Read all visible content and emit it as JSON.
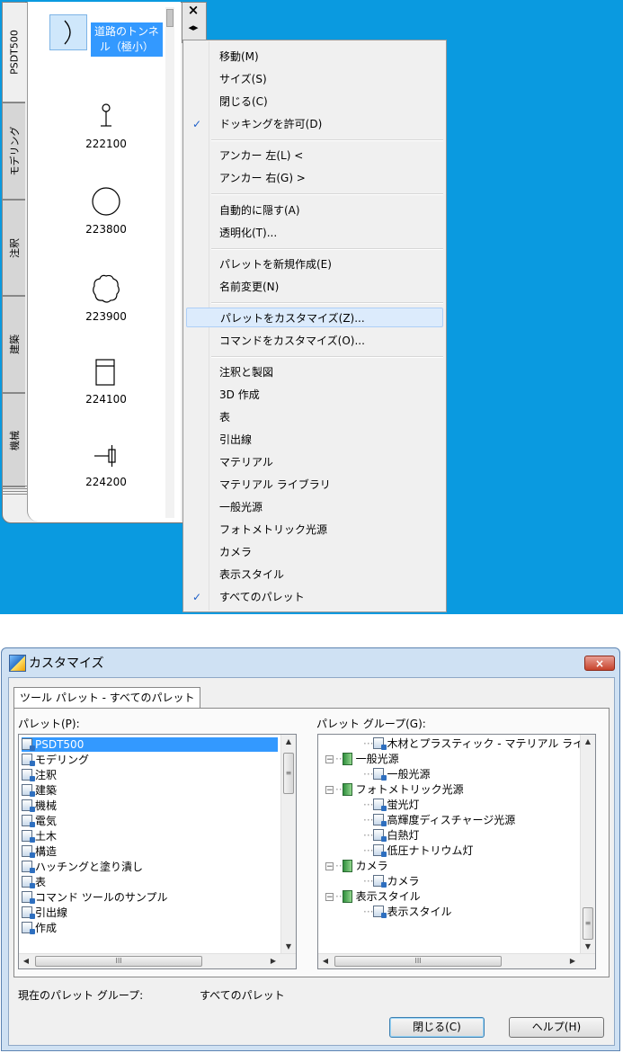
{
  "palette": {
    "tabs": [
      "PSDT500",
      "モデリング",
      "注釈",
      "建築",
      "機械"
    ],
    "items": [
      {
        "label": "道路のトンネル（極小）",
        "line1": "道路のトンネ",
        "line2": "ル（極小）",
        "icon": "tunnel-arc-icon"
      },
      {
        "label": "222100",
        "icon": "pin-marker-icon"
      },
      {
        "label": "223800",
        "icon": "circle-icon"
      },
      {
        "label": "223900",
        "icon": "cloud-circle-icon"
      },
      {
        "label": "224100",
        "icon": "gate-icon"
      },
      {
        "label": "224200",
        "icon": "valve-symbol-icon"
      }
    ],
    "close_glyph": "×",
    "pin_glyph": "◂▸"
  },
  "menu": {
    "items": [
      {
        "label": "移動(M)"
      },
      {
        "label": "サイズ(S)"
      },
      {
        "label": "閉じる(C)"
      },
      {
        "label": "ドッキングを許可(D)",
        "checked": true
      },
      {
        "label": "アンカー 左(L)  <"
      },
      {
        "label": "アンカー 右(G)  >"
      },
      {
        "label": "自動的に隠す(A)"
      },
      {
        "label": "透明化(T)..."
      },
      {
        "label": "パレットを新規作成(E)"
      },
      {
        "label": "名前変更(N)"
      },
      {
        "label": "パレットをカスタマイズ(Z)...",
        "highlighted": true
      },
      {
        "label": "コマンドをカスタマイズ(O)..."
      },
      {
        "label": "注釈と製図"
      },
      {
        "label": "3D 作成"
      },
      {
        "label": "表"
      },
      {
        "label": "引出線"
      },
      {
        "label": "マテリアル"
      },
      {
        "label": "マテリアル ライブラリ"
      },
      {
        "label": "一般光源"
      },
      {
        "label": "フォトメトリック光源"
      },
      {
        "label": "カメラ"
      },
      {
        "label": "表示スタイル"
      },
      {
        "label": "すべてのパレット",
        "checked": true
      }
    ],
    "check_glyph": "✓"
  },
  "dialog": {
    "title": "カスタマイズ",
    "close_glyph": "×",
    "tab": "ツール パレット - すべてのパレット",
    "palettes_label": "パレット(P):",
    "groups_label": "パレット グループ(G):",
    "palettes": [
      "PSDT500",
      "モデリング",
      "注釈",
      "建築",
      "機械",
      "電気",
      "土木",
      "構造",
      "ハッチングと塗り潰し",
      "表",
      "コマンド ツールのサンプル",
      "引出線",
      "作成"
    ],
    "groups": [
      {
        "label": "木材とプラスティック - マテリアル ライブ",
        "level": 2,
        "type": "doc"
      },
      {
        "label": "一般光源",
        "level": 1,
        "type": "group"
      },
      {
        "label": "一般光源",
        "level": 2,
        "type": "doc"
      },
      {
        "label": "フォトメトリック光源",
        "level": 1,
        "type": "group"
      },
      {
        "label": "蛍光灯",
        "level": 2,
        "type": "doc"
      },
      {
        "label": "高輝度ディスチャージ光源",
        "level": 2,
        "type": "doc"
      },
      {
        "label": "白熱灯",
        "level": 2,
        "type": "doc"
      },
      {
        "label": "低圧ナトリウム灯",
        "level": 2,
        "type": "doc"
      },
      {
        "label": "カメラ",
        "level": 1,
        "type": "group"
      },
      {
        "label": "カメラ",
        "level": 2,
        "type": "doc"
      },
      {
        "label": "表示スタイル",
        "level": 1,
        "type": "group"
      },
      {
        "label": "表示スタイル",
        "level": 2,
        "type": "doc"
      }
    ],
    "current_group_label": "現在のパレット グループ:",
    "current_group_value": "すべてのパレット",
    "close_button": "閉じる(C)",
    "help_button": "ヘルプ(H)",
    "scroll": {
      "up": "▲",
      "down": "▼",
      "left": "◀",
      "right": "▶",
      "grip_v": "≡",
      "grip_h": "III"
    }
  }
}
